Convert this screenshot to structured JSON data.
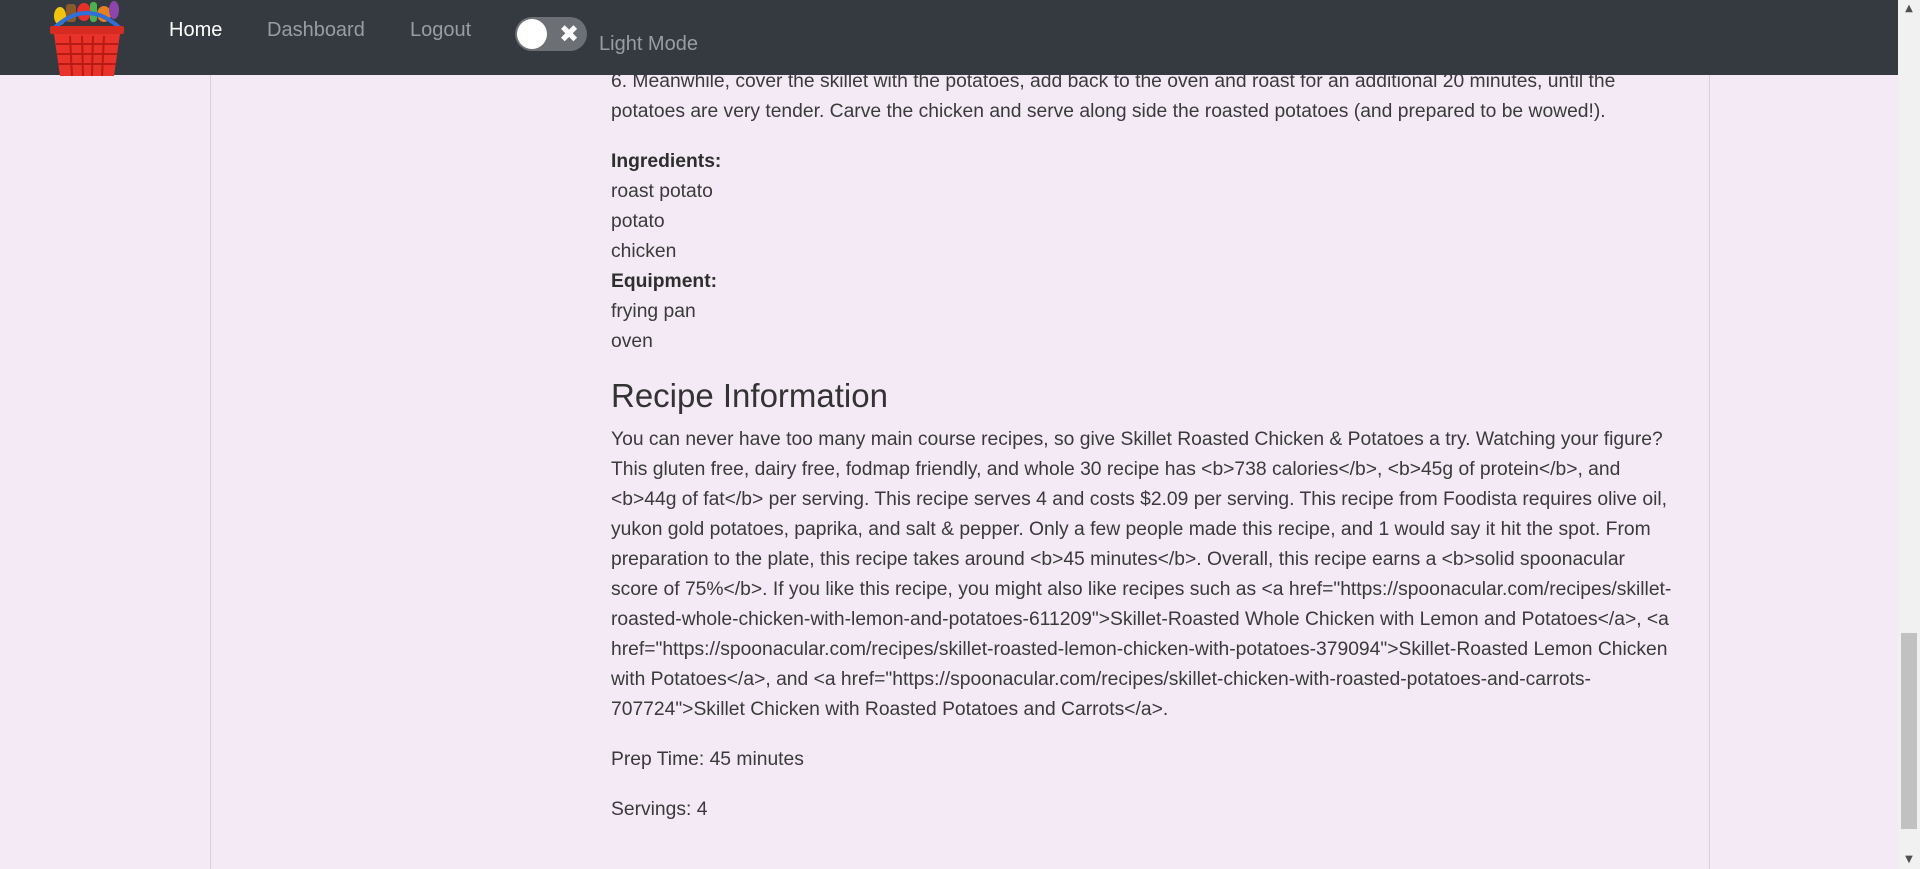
{
  "nav": {
    "items": [
      "Home",
      "Dashboard",
      "Logout"
    ],
    "toggle_label": "Light Mode"
  },
  "recipe": {
    "step6": "6. Meanwhile, cover the skillet with the potatoes, add back to the oven and roast for an additional 20 minutes, until the potatoes are very tender. Carve the chicken and serve along side the roasted potatoes (and prepared to be wowed!).",
    "ingredients_label": "Ingredients:",
    "ingredients": [
      "roast potato",
      "potato",
      "chicken"
    ],
    "equipment_label": "Equipment:",
    "equipment": [
      "frying pan",
      "oven"
    ],
    "info_heading": "Recipe Information",
    "info_text": "You can never have too many main course recipes, so give Skillet Roasted Chicken & Potatoes a try. Watching your figure? This gluten free, dairy free, fodmap friendly, and whole 30 recipe has <b>738 calories</b>, <b>45g of protein</b>, and <b>44g of fat</b> per serving. This recipe serves 4 and costs $2.09 per serving. This recipe from Foodista requires olive oil, yukon gold potatoes, paprika, and salt & pepper. Only a few people made this recipe, and 1 would say it hit the spot. From preparation to the plate, this recipe takes around <b>45 minutes</b>. Overall, this recipe earns a <b>solid spoonacular score of 75%</b>. If you like this recipe, you might also like recipes such as <a href=\"https://spoonacular.com/recipes/skillet-roasted-whole-chicken-with-lemon-and-potatoes-611209\">Skillet-Roasted Whole Chicken with Lemon and Potatoes</a>, <a href=\"https://spoonacular.com/recipes/skillet-roasted-lemon-chicken-with-potatoes-379094\">Skillet-Roasted Lemon Chicken with Potatoes</a>, and <a href=\"https://spoonacular.com/recipes/skillet-chicken-with-roasted-potatoes-and-carrots-707724\">Skillet Chicken with Roasted Potatoes and Carrots</a>.",
    "prep_time": "Prep Time: 45 minutes",
    "servings": "Servings: 4"
  },
  "colors": {
    "navbar": "#343a40",
    "background": "#f3eaf5",
    "nav_active": "#ffffff",
    "nav_inactive": "#9a9da0"
  },
  "icons": {
    "logo": "grocery-basket-icon",
    "toggle": "close-icon"
  }
}
